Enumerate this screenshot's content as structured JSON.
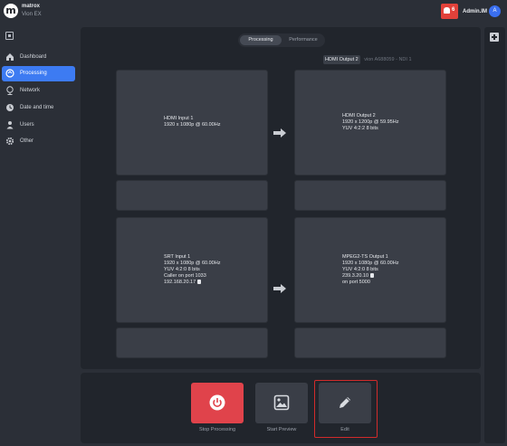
{
  "header": {
    "brand": "matrox",
    "product": "Vion EX",
    "notification_count": "6",
    "user_name": "Admin.IM",
    "avatar_initial": "A"
  },
  "sidebar": {
    "items": [
      {
        "label": "Dashboard",
        "icon": "home-icon"
      },
      {
        "label": "Processing",
        "icon": "processing-icon",
        "active": true
      },
      {
        "label": "Network",
        "icon": "globe-icon"
      },
      {
        "label": "Date and time",
        "icon": "clock-icon"
      },
      {
        "label": "Users",
        "icon": "user-icon"
      },
      {
        "label": "Other",
        "icon": "gear-icon"
      }
    ]
  },
  "tabs": {
    "processing": "Processing",
    "performance": "Performance"
  },
  "output_select": {
    "selected": "HDMI Output 2",
    "other": "vion A688059 - NDI 1"
  },
  "cards": {
    "hdmi_input": {
      "title": "HDMI Input 1",
      "line1": "1920 x 1080p @ 60.00Hz"
    },
    "hdmi_output": {
      "title": "HDMI Output 2",
      "line1": "1920 x 1200p @ 59.95Hz",
      "line2": "YUV 4:2:2 8 bits"
    },
    "srt_input": {
      "title": "SRT Input 1",
      "line1": "1920 x 1080p @ 60.00Hz",
      "line2": "YUV 4:2:0 8 bits",
      "line3": "Caller on port 1033",
      "line4": "192.168.20.17"
    },
    "mpeg_output": {
      "title": "MPEG2-TS Output 1",
      "line1": "1920 x 1080p @ 60.00Hz",
      "line2": "YUV 4:2:0 8 bits",
      "line3": "239.3.20.10",
      "line4": "on port 5000"
    }
  },
  "actions": {
    "stop": "Stop Processing",
    "preview": "Start Preview",
    "edit": "Edit"
  },
  "colors": {
    "accent": "#3d7bf2",
    "stop": "#e0434b",
    "notification": "#e2413a",
    "highlight": "#d12b2b"
  }
}
